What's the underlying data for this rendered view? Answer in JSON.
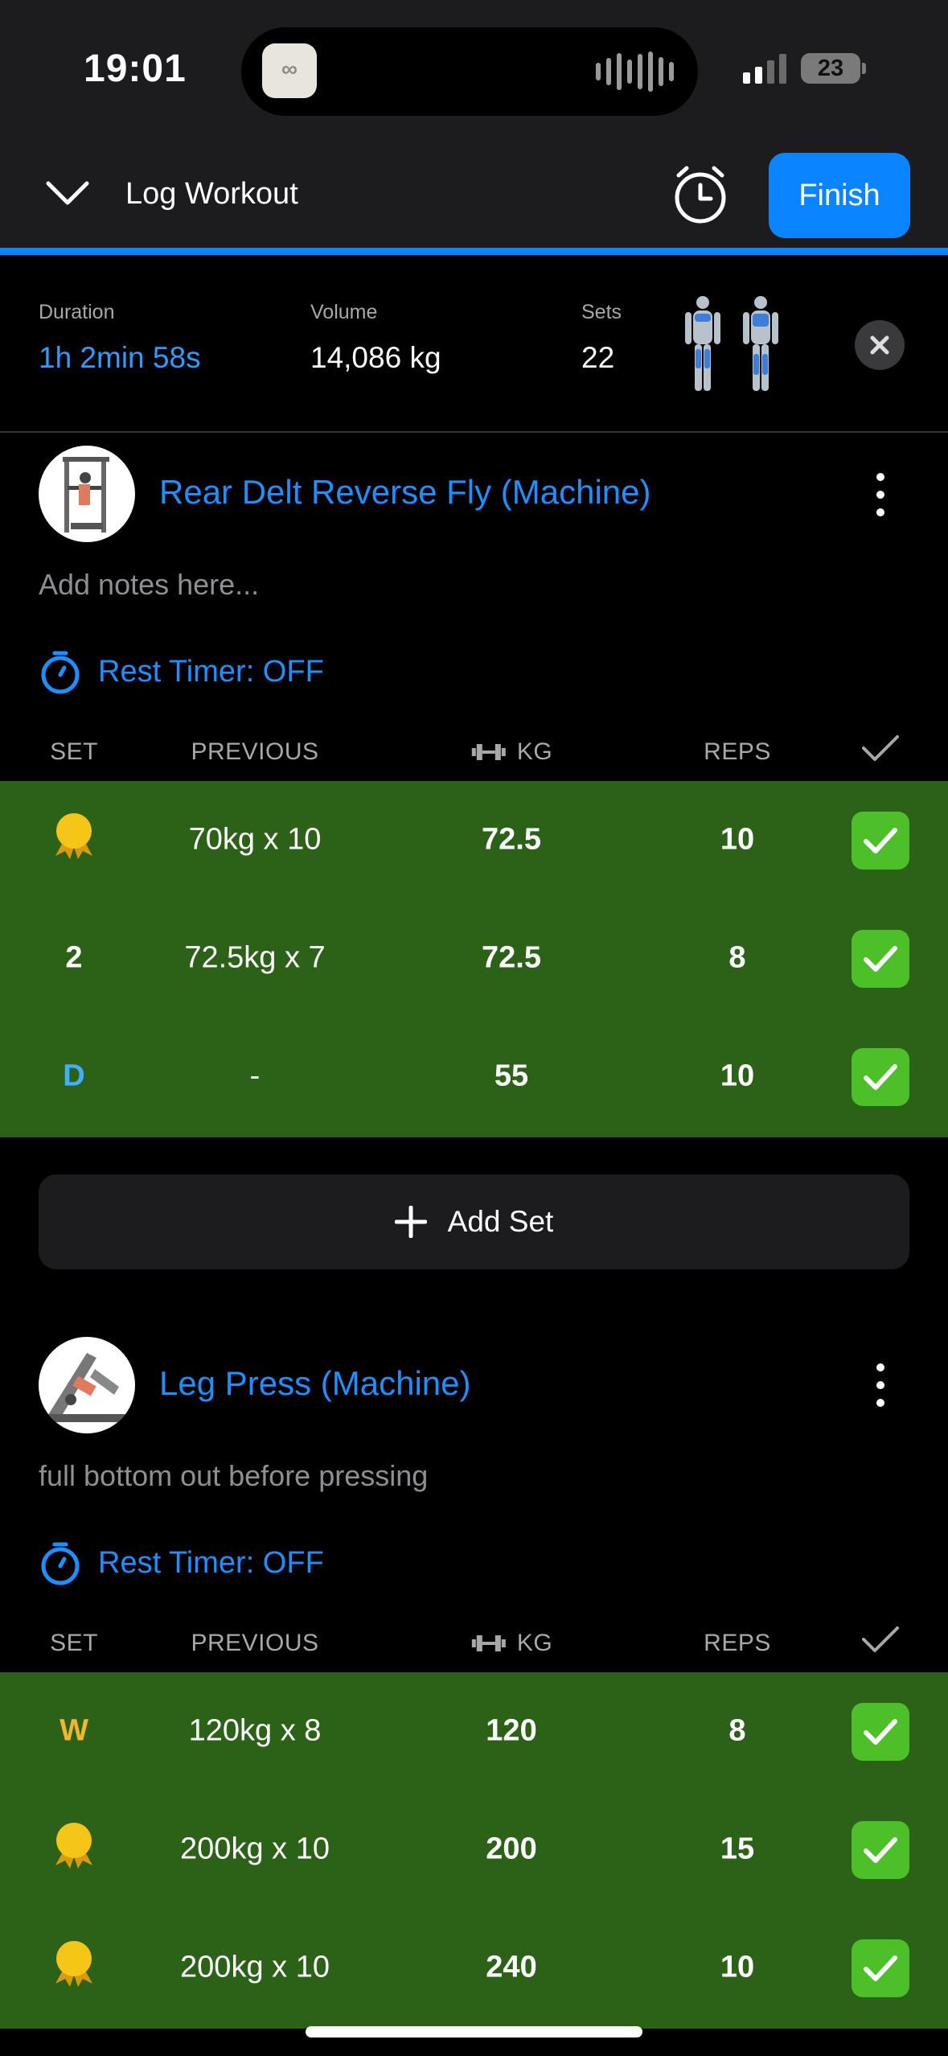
{
  "status_bar": {
    "time": "19:01",
    "battery": "23"
  },
  "header": {
    "title": "Log Workout",
    "finish_label": "Finish"
  },
  "summary": {
    "duration_label": "Duration",
    "duration_value": "1h 2min 58s",
    "volume_label": "Volume",
    "volume_value": "14,086 kg",
    "sets_label": "Sets",
    "sets_value": "22"
  },
  "table_headers": {
    "set": "SET",
    "previous": "PREVIOUS",
    "kg": "KG",
    "reps": "REPS"
  },
  "exercises": [
    {
      "name": "Rear Delt Reverse Fly (Machine)",
      "notes": "Add notes here...",
      "rest_timer": "Rest Timer: OFF",
      "sets": [
        {
          "set": "medal",
          "previous": "70kg x 10",
          "kg": "72.5",
          "reps": "10",
          "done": true
        },
        {
          "set": "2",
          "previous": "72.5kg x 7",
          "kg": "72.5",
          "reps": "8",
          "done": true
        },
        {
          "set": "D",
          "previous": "-",
          "kg": "55",
          "reps": "10",
          "done": true
        }
      ]
    },
    {
      "name": "Leg Press (Machine)",
      "notes": "full bottom out before pressing",
      "rest_timer": "Rest Timer: OFF",
      "sets": [
        {
          "set": "W",
          "previous": "120kg x 8",
          "kg": "120",
          "reps": "8",
          "done": true
        },
        {
          "set": "medal",
          "previous": "200kg x 10",
          "kg": "200",
          "reps": "15",
          "done": true
        },
        {
          "set": "medal",
          "previous": "200kg x 10",
          "kg": "240",
          "reps": "10",
          "done": true
        }
      ]
    }
  ],
  "add_set_label": "Add Set",
  "colors": {
    "accent": "#0a84ff",
    "row_done": "#2c6218",
    "check": "#4cbf29",
    "medal": "#f5c518"
  }
}
